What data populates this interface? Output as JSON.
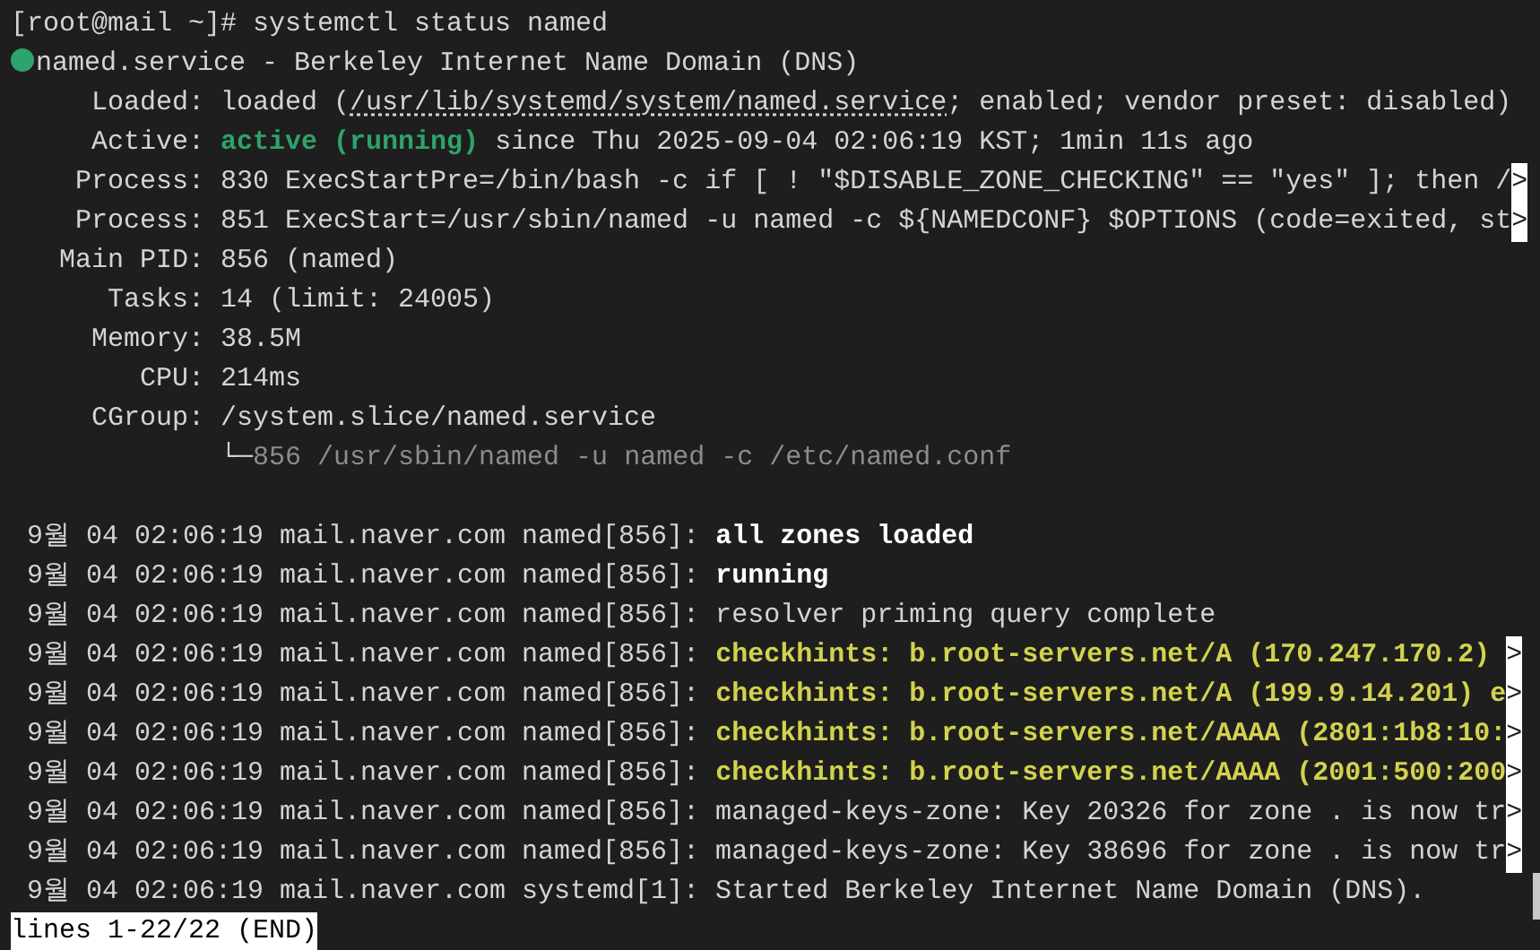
{
  "lines": [
    {
      "kind": "text",
      "segments": [
        {
          "kind": "plain",
          "text": "[root@mail ~]# systemctl status named"
        }
      ]
    },
    {
      "kind": "text",
      "segments": [
        {
          "kind": "dot",
          "color": "#2ea36b"
        },
        {
          "kind": "plain",
          "text": "named.service - Berkeley Internet Name Domain (DNS)"
        }
      ]
    },
    {
      "kind": "text",
      "segments": [
        {
          "kind": "plain",
          "text": "     Loaded: loaded ("
        },
        {
          "kind": "link",
          "text": "/usr/lib/systemd/system/named.service"
        },
        {
          "kind": "plain",
          "text": "; enabled; vendor preset: disabled)"
        }
      ]
    },
    {
      "kind": "text",
      "segments": [
        {
          "kind": "plain",
          "text": "     Active: "
        },
        {
          "kind": "active",
          "text": "active (running)"
        },
        {
          "kind": "plain",
          "text": " since Thu 2025-09-04 02:06:19 KST; 1min 11s ago"
        }
      ]
    },
    {
      "kind": "text",
      "segments": [
        {
          "kind": "plain",
          "text": "    Process: 830 ExecStartPre=/bin/bash -c if [ ! \"$DISABLE_ZONE_CHECKING\" == \"yes\" ]; then /"
        }
      ],
      "overflow_marker": ">"
    },
    {
      "kind": "text",
      "segments": [
        {
          "kind": "plain",
          "text": "    Process: 851 ExecStart=/usr/sbin/named -u named -c ${NAMEDCONF} $OPTIONS (code=exited, st"
        }
      ],
      "overflow_marker": ">"
    },
    {
      "kind": "text",
      "segments": [
        {
          "kind": "plain",
          "text": "   Main PID: 856 (named)"
        }
      ]
    },
    {
      "kind": "text",
      "segments": [
        {
          "kind": "plain",
          "text": "      Tasks: 14 (limit: 24005)"
        }
      ]
    },
    {
      "kind": "text",
      "segments": [
        {
          "kind": "plain",
          "text": "     Memory: 38.5M"
        }
      ]
    },
    {
      "kind": "text",
      "segments": [
        {
          "kind": "plain",
          "text": "        CPU: 214ms"
        }
      ]
    },
    {
      "kind": "text",
      "segments": [
        {
          "kind": "plain",
          "text": "     CGroup: /system.slice/named.service"
        }
      ]
    },
    {
      "kind": "text",
      "segments": [
        {
          "kind": "plain",
          "text": "             └─"
        },
        {
          "kind": "dim",
          "text": "856 /usr/sbin/named -u named -c /etc/named.conf"
        }
      ]
    },
    {
      "kind": "blank"
    },
    {
      "kind": "text",
      "segments": [
        {
          "kind": "plain",
          "text": " 9월 04 02:06:19 mail.naver.com named[856]: "
        },
        {
          "kind": "bold",
          "text": "all zones loaded"
        }
      ]
    },
    {
      "kind": "text",
      "segments": [
        {
          "kind": "plain",
          "text": " 9월 04 02:06:19 mail.naver.com named[856]: "
        },
        {
          "kind": "bold",
          "text": "running"
        }
      ]
    },
    {
      "kind": "text",
      "segments": [
        {
          "kind": "plain",
          "text": " 9월 04 02:06:19 mail.naver.com named[856]: resolver priming query complete"
        }
      ]
    },
    {
      "kind": "text",
      "segments": [
        {
          "kind": "plain",
          "text": " 9월 04 02:06:19 mail.naver.com named[856]: "
        },
        {
          "kind": "warn",
          "text": "checkhints: b.root-servers.net/A (170.247.170.2) "
        }
      ],
      "overflow_marker": ">"
    },
    {
      "kind": "text",
      "segments": [
        {
          "kind": "plain",
          "text": " 9월 04 02:06:19 mail.naver.com named[856]: "
        },
        {
          "kind": "warn",
          "text": "checkhints: b.root-servers.net/A (199.9.14.201) e"
        }
      ],
      "overflow_marker": ">"
    },
    {
      "kind": "text",
      "segments": [
        {
          "kind": "plain",
          "text": " 9월 04 02:06:19 mail.naver.com named[856]: "
        },
        {
          "kind": "warn",
          "text": "checkhints: b.root-servers.net/AAAA (2801:1b8:10:"
        }
      ],
      "overflow_marker": ">"
    },
    {
      "kind": "text",
      "segments": [
        {
          "kind": "plain",
          "text": " 9월 04 02:06:19 mail.naver.com named[856]: "
        },
        {
          "kind": "warn",
          "text": "checkhints: b.root-servers.net/AAAA (2001:500:200"
        }
      ],
      "overflow_marker": ">"
    },
    {
      "kind": "text",
      "segments": [
        {
          "kind": "plain",
          "text": " 9월 04 02:06:19 mail.naver.com named[856]: managed-keys-zone: Key 20326 for zone . is now tr"
        }
      ],
      "overflow_marker": ">"
    },
    {
      "kind": "text",
      "segments": [
        {
          "kind": "plain",
          "text": " 9월 04 02:06:19 mail.naver.com named[856]: managed-keys-zone: Key 38696 for zone . is now tr"
        }
      ],
      "overflow_marker": ">"
    },
    {
      "kind": "text",
      "segments": [
        {
          "kind": "plain",
          "text": " 9월 04 02:06:19 mail.naver.com systemd[1]: Started Berkeley Internet Name Domain (DNS)."
        }
      ]
    }
  ],
  "status_bar": {
    "text": "lines 1-22/22 (END)"
  }
}
